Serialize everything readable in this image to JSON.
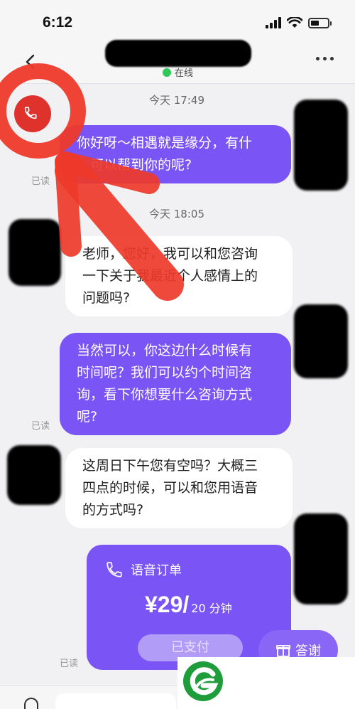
{
  "status_bar": {
    "time": "6:12",
    "battery_level": 0.5
  },
  "header": {
    "status_text": "在线"
  },
  "chat": {
    "messages": [
      {
        "type": "time",
        "text": "今天 17:49"
      },
      {
        "type": "out",
        "lines": [
          "你好呀～相遇就是缘分，有什",
          "么可以帮到你的呢?"
        ],
        "read": "已读"
      },
      {
        "type": "time",
        "text": "今天 18:05"
      },
      {
        "type": "in",
        "lines": [
          "老师，您好，我可以和您咨询",
          "一下关于我最近个人感情上的",
          "问题吗?"
        ]
      },
      {
        "type": "out",
        "lines": [
          "当然可以，你这边什么时候有",
          "时间呢？我们可以约个时间咨",
          "询，看下你想要什么咨询方式",
          "呢?"
        ],
        "read": "已读"
      },
      {
        "type": "in",
        "lines": [
          "这周日下午您有空吗？大概三",
          "四点的时候，可以和您用语音",
          "的方式吗?"
        ]
      }
    ],
    "order": {
      "title": "语音订单",
      "price": "¥29/",
      "unit": "20 分钟",
      "button": "已支付",
      "read": "已读"
    },
    "thanks_button": "答谢"
  },
  "colors": {
    "accent": "#7b54f5",
    "annotation": "#ee3a2a",
    "online": "#2fc95a"
  },
  "icons": [
    "back-arrow-icon",
    "more-dots-icon",
    "phone-icon",
    "gift-icon",
    "mic-icon"
  ]
}
